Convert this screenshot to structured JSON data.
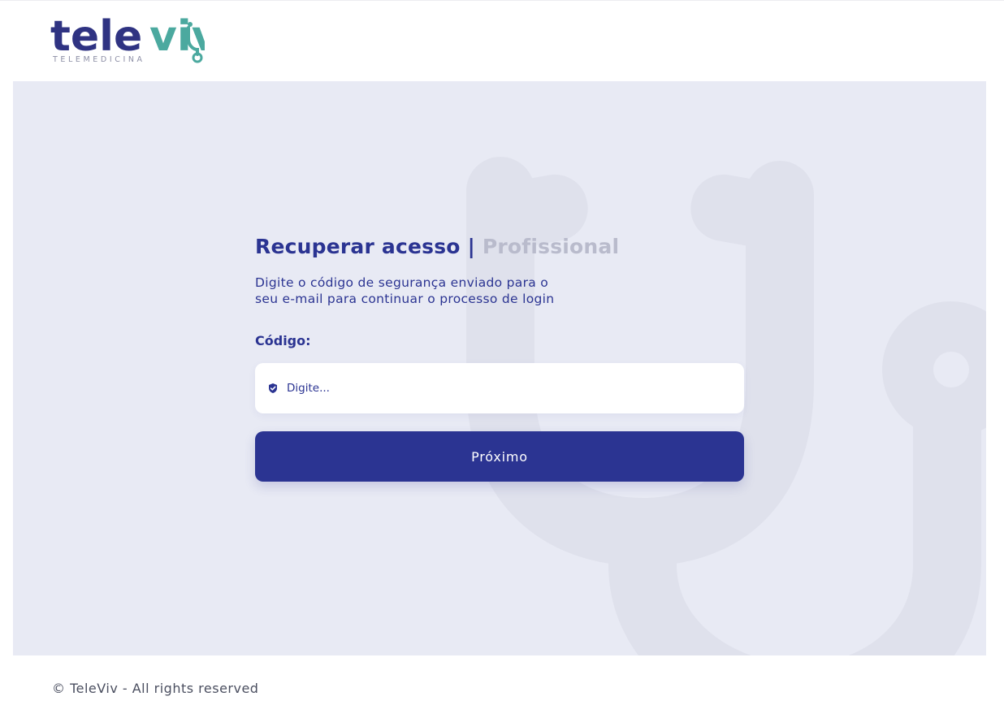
{
  "brand": {
    "logo_main": "tele",
    "logo_accent": "viv",
    "logo_sub": "TELEMEDICINA"
  },
  "form": {
    "title_main": "Recuperar acesso",
    "title_sep": "|",
    "title_role": "Profissional",
    "subtitle_line1": "Digite o código de segurança enviado para o",
    "subtitle_line2": "seu e-mail para continuar o processo de login",
    "code_label": "Código:",
    "code_placeholder": "Digite...",
    "code_value": "",
    "submit_label": "Próximo"
  },
  "footer": {
    "copyright": "© TeleViv - All rights reserved"
  },
  "colors": {
    "primary": "#2b3492",
    "accent": "#4ba99f",
    "panel_bg": "#e8eaf4",
    "muted": "#b9bbcc"
  },
  "icons": {
    "input_icon": "shield-check-icon",
    "background_graphic": "stethoscope-watermark-icon",
    "logo_graphic": "stethoscope-icon"
  }
}
